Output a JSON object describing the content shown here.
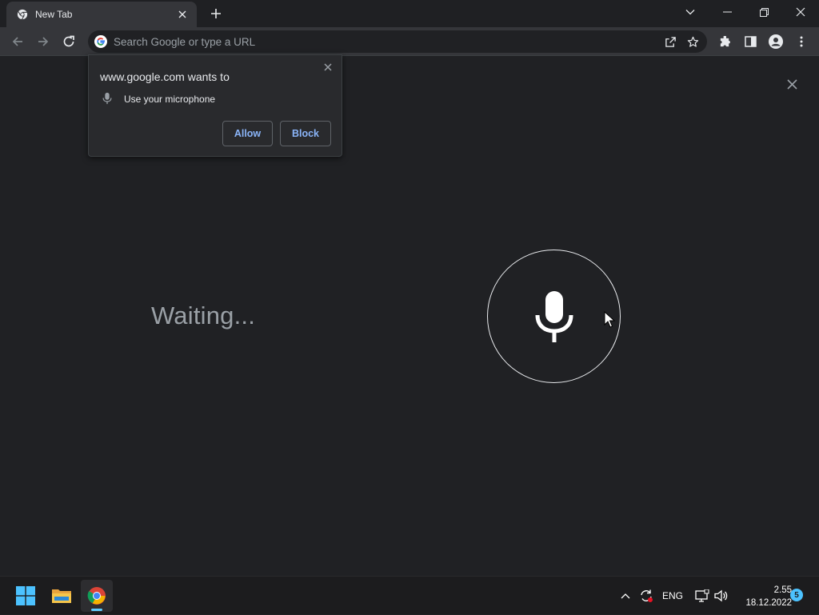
{
  "browser": {
    "tab": {
      "title": "New Tab"
    },
    "omnibox": {
      "placeholder": "Search Google or type a URL"
    }
  },
  "permission_popup": {
    "title": "www.google.com wants to",
    "permission": "Use your microphone",
    "allow_label": "Allow",
    "block_label": "Block"
  },
  "voice_search": {
    "status": "Waiting..."
  },
  "taskbar": {
    "language": "ENG",
    "time": "2.55",
    "date": "18.12.2022",
    "notification_count": "5"
  },
  "colors": {
    "background": "#202124",
    "accent_blue": "#8ab4f8",
    "taskbar_accent": "#60cdff"
  }
}
